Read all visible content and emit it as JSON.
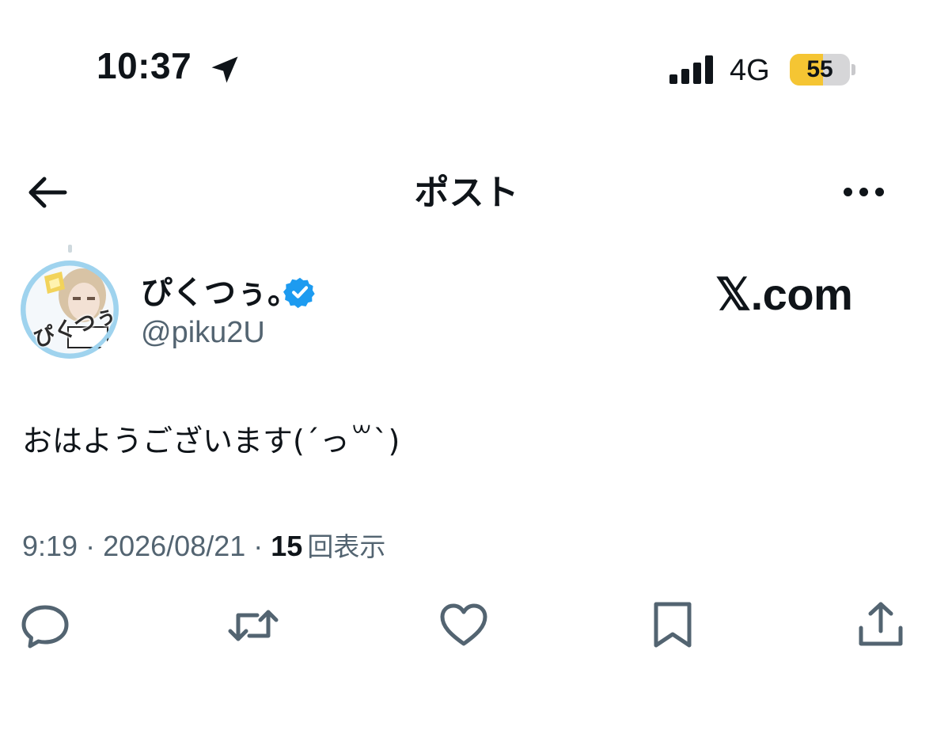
{
  "status_bar": {
    "time": "10:37",
    "network": "4G",
    "battery": "55",
    "battery_level": 0.55,
    "signal_bars": 4,
    "icons": [
      "location-arrow-icon",
      "signal-icon",
      "battery-icon"
    ]
  },
  "nav": {
    "title": "ポスト",
    "back_icon": "arrow-left-icon",
    "more_icon": "more-horizontal-icon"
  },
  "author": {
    "display_name": "ぴくつぅ。",
    "handle": "@piku2U",
    "verified": true,
    "avatar_text": "ぴくつぅ"
  },
  "watermark": "𝕏.com",
  "tweet": {
    "text": "おはようございます(ˊっ꒳ˋ)"
  },
  "meta": {
    "time": "9:19",
    "separator": " · ",
    "date": "2026/08/21",
    "views_count": "15",
    "views_label": "回表示"
  },
  "actions": [
    {
      "icon": "reply-icon"
    },
    {
      "icon": "repost-icon"
    },
    {
      "icon": "like-icon"
    },
    {
      "icon": "bookmark-icon"
    },
    {
      "icon": "share-icon"
    }
  ],
  "colors": {
    "text": "#0f1419",
    "secondary": "#536471",
    "verified": "#1d9bf0",
    "battery": "#f5c533"
  }
}
